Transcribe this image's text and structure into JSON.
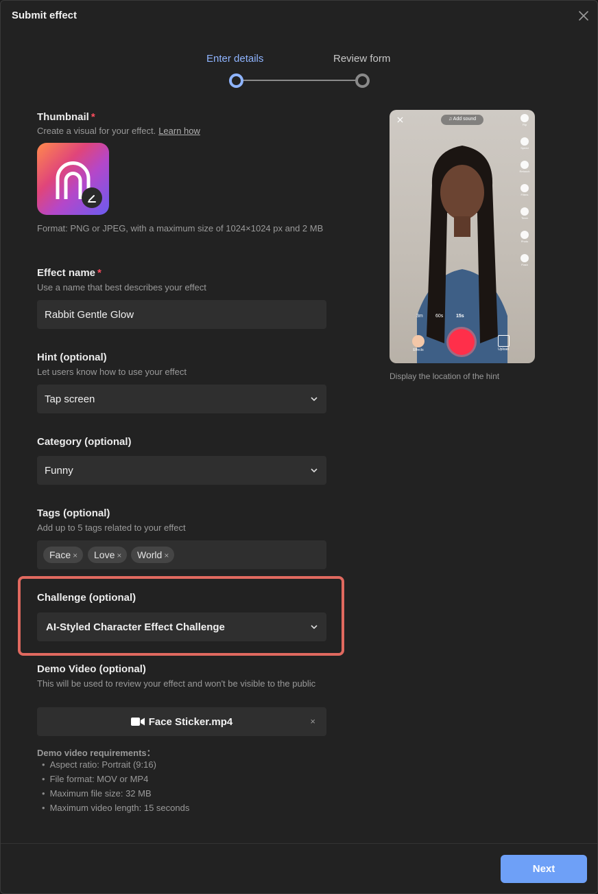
{
  "dialog": {
    "title": "Submit effect"
  },
  "stepper": {
    "step1": "Enter details",
    "step2": "Review form",
    "active_color": "#8fb4ff"
  },
  "thumbnail": {
    "label": "Thumbnail",
    "required": "*",
    "desc": "Create a visual for your effect.",
    "learn_link": "Learn how",
    "format_note": "Format: PNG or JPEG, with a maximum size of 1024×1024 px and 2 MB",
    "icon": "arch-logo-icon"
  },
  "effect_name": {
    "label": "Effect name",
    "required": "*",
    "desc": "Use a name that best describes your effect",
    "value": "Rabbit Gentle Glow"
  },
  "hint": {
    "label": "Hint (optional)",
    "desc": "Let users know how to use your effect",
    "value": "Tap screen"
  },
  "category": {
    "label": "Category (optional)",
    "value": "Funny"
  },
  "tags": {
    "label": "Tags (optional)",
    "desc": "Add up to 5 tags related to your effect",
    "items": [
      "Face",
      "Love",
      "World"
    ],
    "remove": "×"
  },
  "challenge": {
    "label": "Challenge (optional)",
    "value": "AI-Styled Character Effect Challenge",
    "highlight_color": "#e0695f"
  },
  "demo_video": {
    "label": "Demo Video (optional)",
    "desc": "This will be used to review your effect and won't be visible to the public",
    "file_name": "Face Sticker.mp4",
    "remove": "×",
    "requirements_title": "Demo video requirements：",
    "requirements": [
      "Aspect ratio: Portrait (9:16)",
      "File format: MOV or MP4",
      "Maximum file size: 32 MB",
      "Maximum video length: 15 seconds"
    ]
  },
  "preview": {
    "caption": "Display the location of the hint",
    "add_sound": "♫ Add sound",
    "side_labels": [
      "Flip",
      "Speed",
      "Retouch",
      "Filters",
      "Timer",
      "Photo",
      "Flash"
    ],
    "timers": [
      "3m",
      "60s",
      "15s"
    ],
    "effects_label": "Effects",
    "upload_label": "Upload"
  },
  "footer": {
    "next_label": "Next",
    "primary_color": "#6ea0f7"
  }
}
